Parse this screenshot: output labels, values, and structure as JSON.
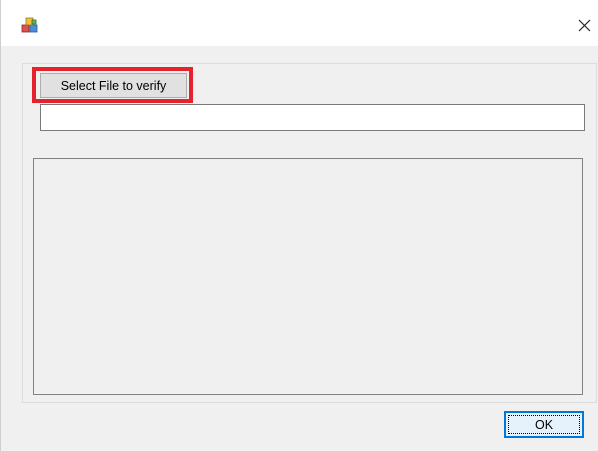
{
  "window": {
    "title": "",
    "icon": "app-blocks-icon",
    "close_icon": "close-icon"
  },
  "dialog": {
    "select_button_label": "Select File to verify",
    "file_path_value": "",
    "output_text": "",
    "ok_button_label": "OK"
  },
  "colors": {
    "highlight": "#e3242b",
    "ok_border": "#0078d7"
  }
}
